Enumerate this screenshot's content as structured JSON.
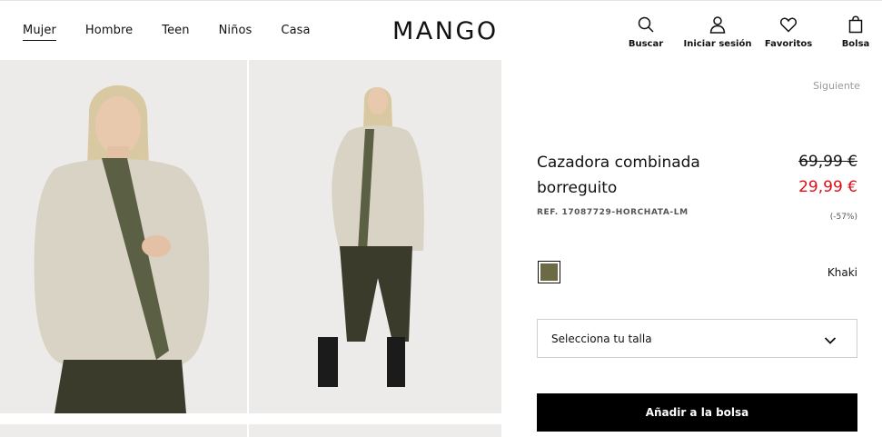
{
  "nav": {
    "items": [
      {
        "label": "Mujer",
        "active": true
      },
      {
        "label": "Hombre",
        "active": false
      },
      {
        "label": "Teen",
        "active": false
      },
      {
        "label": "Niños",
        "active": false
      },
      {
        "label": "Casa",
        "active": false
      }
    ]
  },
  "header": {
    "logo": "MANGO",
    "actions": {
      "search": "Buscar",
      "login": "Iniciar sesión",
      "favorites": "Favoritos",
      "bag": "Bolsa"
    }
  },
  "product": {
    "next_label": "Siguiente",
    "title": "Cazadora combinada borreguito",
    "price_old": "69,99 €",
    "price_new": "29,99 €",
    "reference": "REF. 17087729-HORCHATA-LM",
    "discount": "(-57%)",
    "color": {
      "name": "Khaki",
      "hex": "#6b6a45"
    },
    "size_placeholder": "Selecciona tu talla",
    "add_to_bag": "Añadir a la bolsa",
    "price_color": "#e00d18"
  }
}
